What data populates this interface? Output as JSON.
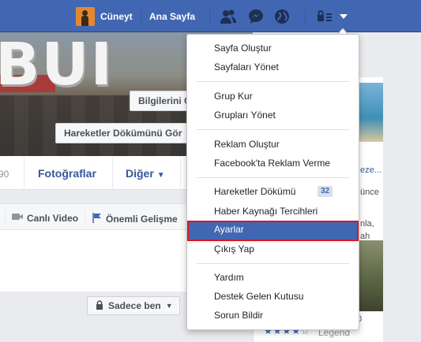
{
  "topbar": {
    "user_name": "Cüneyt",
    "home_label": "Ana Sayfa",
    "bg_color": "#4267b2",
    "icons": [
      "friend-requests-icon",
      "messenger-icon",
      "notifications-globe-icon",
      "privacy-shortcuts-icon",
      "account-menu-arrow-icon"
    ]
  },
  "profile": {
    "cover_button_info": "Bilgilerini G",
    "cover_button_activity": "Hareketler Dökümünü Gör",
    "tab_count_partial": "90",
    "tab_photos": "Fotoğraflar",
    "tab_more": "Diğer",
    "live_video": "Canlı Video",
    "life_event": "Önemli Gelişme",
    "privacy": "Sadece ben"
  },
  "rightcol": {
    "text_1": "eze...",
    "text_2": "ünce",
    "text_3": "nla,",
    "text_4": "ah",
    "text_5": "0",
    "legend": "Legend"
  },
  "menu": {
    "group1": [
      "Sayfa Oluştur",
      "Sayfaları Yönet"
    ],
    "group2": [
      "Grup Kur",
      "Grupları Yönet"
    ],
    "group3": [
      "Reklam Oluştur",
      "Facebook'ta Reklam Verme"
    ],
    "activity_log": "Hareketler Dökümü",
    "activity_log_badge": "32",
    "news_feed_prefs": "Haber Kaynağı Tercihleri",
    "settings": "Ayarlar",
    "logout": "Çıkış Yap",
    "group5": [
      "Yardım",
      "Destek Gelen Kutusu",
      "Sorun Bildir"
    ],
    "highlight_color": "#4267b2",
    "annotation_color": "#e0141e"
  }
}
